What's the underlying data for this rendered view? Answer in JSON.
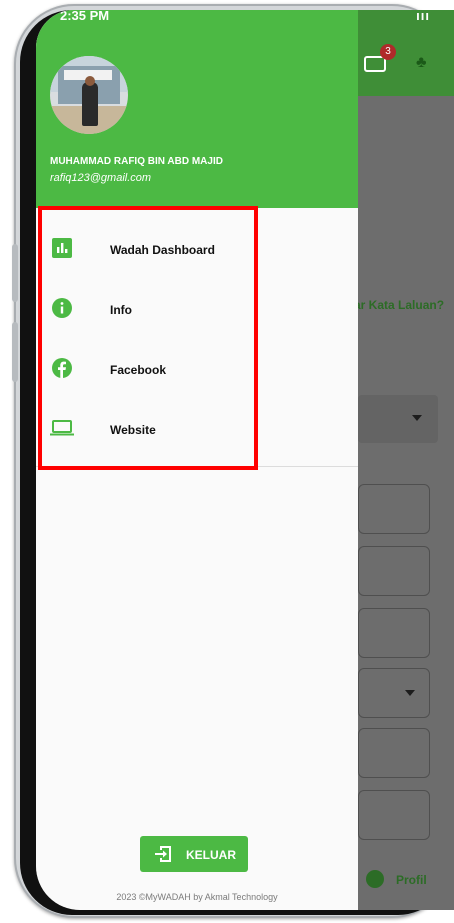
{
  "status_bar": {
    "time": "2:35 PM",
    "right": "ııı"
  },
  "background_app": {
    "notification_count": "3",
    "forgot_link": "ar Kata Laluan?",
    "bottom_nav_profile": "Profil"
  },
  "drawer": {
    "user": {
      "name": "MUHAMMAD RAFIQ BIN  ABD MAJID",
      "email": "rafiq123@gmail.com"
    },
    "menu": [
      {
        "label": "Wadah Dashboard",
        "icon": "bar-chart-icon"
      },
      {
        "label": "Info",
        "icon": "info-icon"
      },
      {
        "label": "Facebook",
        "icon": "facebook-icon"
      },
      {
        "label": "Website",
        "icon": "laptop-icon"
      }
    ],
    "logout_label": "KELUAR",
    "footer": "2023 ©MyWADAH by Akmal Technology"
  },
  "colors": {
    "accent": "#4cb944",
    "highlight": "#ff0000"
  }
}
